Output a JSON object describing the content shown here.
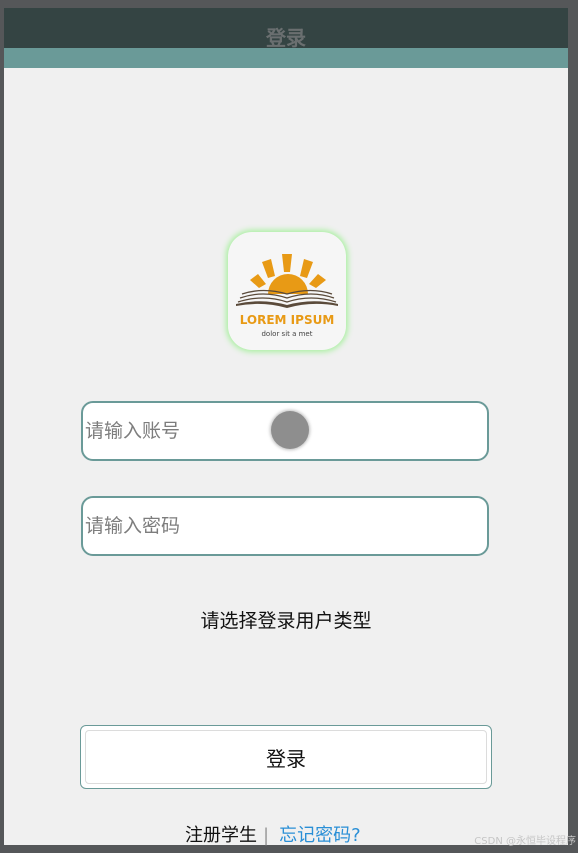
{
  "header": {
    "title": "登录"
  },
  "logo": {
    "title": "LOREM IPSUM",
    "subtitle": "dolor sit a met"
  },
  "form": {
    "account_placeholder": "请输入账号",
    "password_placeholder": "请输入密码",
    "user_type_prompt": "请选择登录用户类型",
    "login_label": "登录"
  },
  "links": {
    "register": "注册学生",
    "separator": "|",
    "forgot": "忘记密码?"
  },
  "watermark": "CSDN @永恒毕设程序",
  "colors": {
    "header": "#6a9a98",
    "accent_link": "#2a8fd6",
    "logo_orange": "#e89a15",
    "logo_glow": "#a9f0a0"
  }
}
